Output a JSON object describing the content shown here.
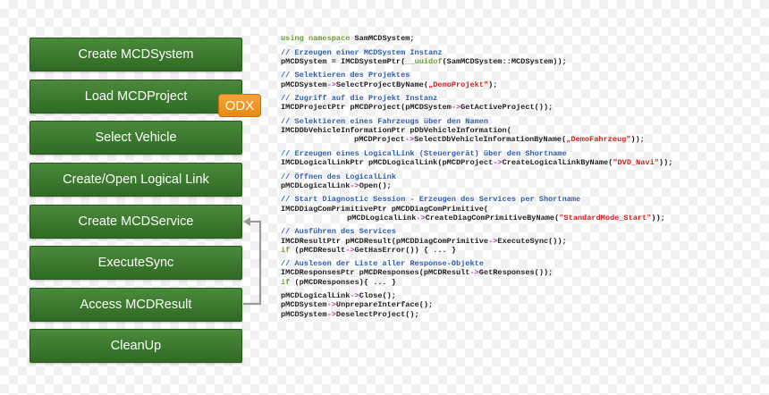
{
  "steps": [
    {
      "label": "Create MCDSystem"
    },
    {
      "label": "Load MCDProject"
    },
    {
      "label": "Select Vehicle"
    },
    {
      "label": "Create/Open Logical Link"
    },
    {
      "label": "Create MCDService"
    },
    {
      "label": "ExecuteSync"
    },
    {
      "label": "Access MCDResult"
    },
    {
      "label": "CleanUp"
    }
  ],
  "badge": {
    "label": "ODX"
  },
  "code": {
    "using": {
      "kw": "using namespace",
      "txt": " SamMCDSystem;"
    },
    "b1": {
      "comment": "// Erzeugen einer MCDSystem Instanz",
      "a": "pMCDSystem = IMCDSystemPtr(",
      "kw": "__uuidof",
      "b": "(SamMCDSystem::MCDSystem));"
    },
    "b2": {
      "comment": "// Selektieren des Projektes",
      "a": "pMCDSystem",
      "op": "->",
      "b": "SelectProjectByName(",
      "str": "„DemoProjekt\"",
      "c": ");"
    },
    "b3": {
      "comment": "// Zugriff auf die Projekt Instanz",
      "a": "IMCDProjectPtr pMCDProject(pMCDSystem",
      "op": "->",
      "b": "GetActiveProject());"
    },
    "b4": {
      "comment": "// Selektieren eines Fahrzeugs über den Namen",
      "l1": "IMCDDbVehicleInformationPtr pDbVehicleInformation(",
      "a": "pMCDProject",
      "op": "->",
      "b": "SelectDbVehicleInformationByName(",
      "str": "„DemoFahrzeug\"",
      "c": "));"
    },
    "b5": {
      "comment": "// Erzeugen eines LogicalLink (Steuergerät) über den Shortname",
      "a": "IMCDLogicalLinkPtr pMCDLogicalLink(pMCDProject",
      "op": "->",
      "b": "CreateLogicalLinkByName(",
      "str": "\"DVD_Navi\"",
      "c": "));"
    },
    "b6": {
      "comment": "// Öffnen des LogicalLink",
      "a": "pMCDLogicalLink",
      "op": "->",
      "b": "Open();"
    },
    "b7": {
      "comment": "// Start Diagnostic Session - Erzeugen des Services per Shortname",
      "l1": "IMCDDiagComPrimitivePtr pMCDDiagComPrimitive(",
      "a": "pMCDLogicalLink",
      "op": "->",
      "b": "CreateDiagComPrimitiveByName(",
      "str": "\"StandardMode_Start\"",
      "c": "));"
    },
    "b8": {
      "comment": "// Ausführen des Services",
      "a": "IMCDResultPtr pMCDResult(pMCDDiagComPrimitive",
      "op": "->",
      "b": "ExecuteSync());",
      "kw": "if",
      "d": " (pMCDResult",
      "op2": "->",
      "e": "GetHasError()) { ... }"
    },
    "b9": {
      "comment": "// Auslesen der Liste aller Response-Objekte",
      "a": "IMCDResponsesPtr pMCDResponses(pMCDResult",
      "op": "->",
      "b": "GetResponses());",
      "kw": "if",
      "d": " (pMCDResponses){ ... }"
    },
    "b10": {
      "a1": "pMCDLogicalLink",
      "op1": "->",
      "b1": "Close();",
      "a2": "pMCDSystem",
      "op2": "->",
      "b2": "UnprepareInterface();",
      "a3": "pMCDSystem",
      "op3": "->",
      "b3": "DeselectProject();"
    }
  }
}
